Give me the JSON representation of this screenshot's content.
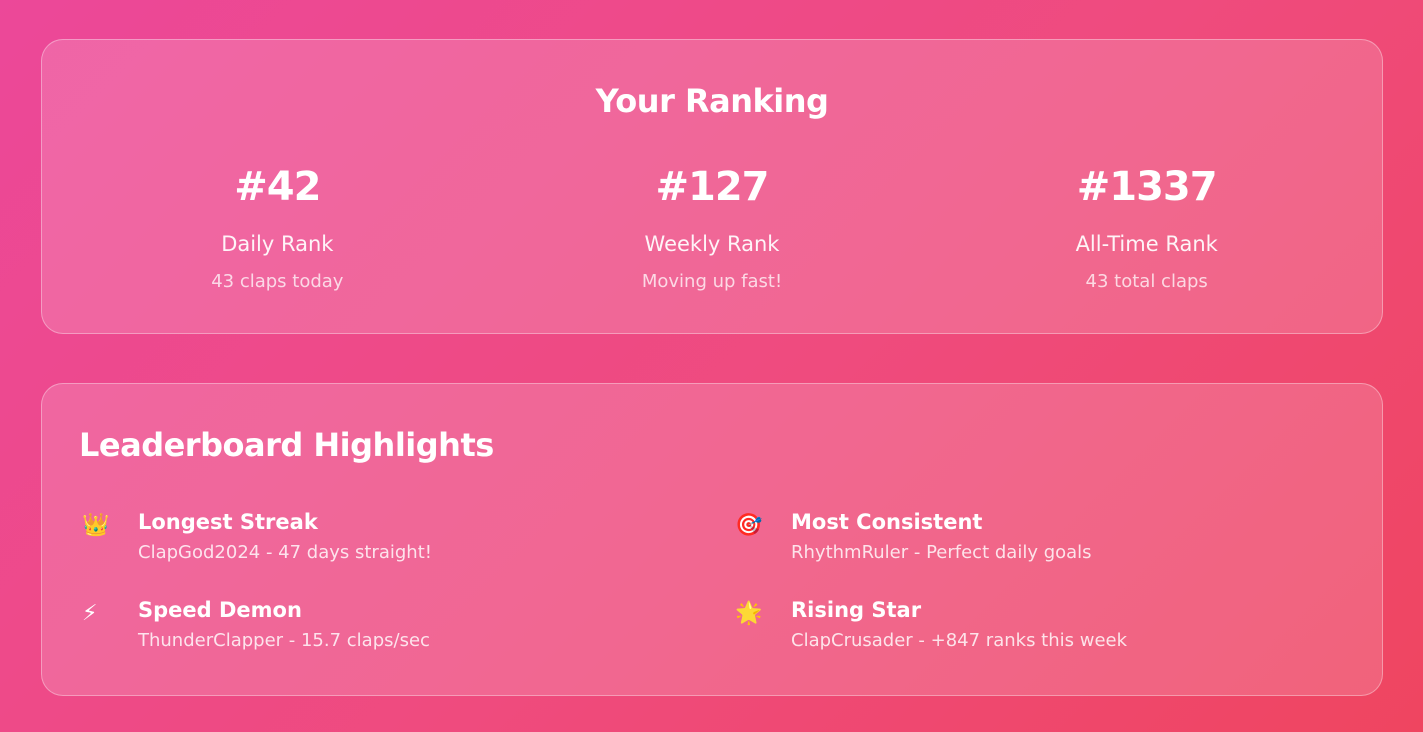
{
  "ranking": {
    "title": "Your Ranking",
    "items": [
      {
        "value": "#42",
        "label": "Daily Rank",
        "sub": "43 claps today"
      },
      {
        "value": "#127",
        "label": "Weekly Rank",
        "sub": "Moving up fast!"
      },
      {
        "value": "#1337",
        "label": "All-Time Rank",
        "sub": "43 total claps"
      }
    ]
  },
  "highlights": {
    "title": "Leaderboard Highlights",
    "items": [
      {
        "icon": "crown-icon",
        "glyph": "👑",
        "name": "Longest Streak",
        "desc": "ClapGod2024 - 47 days straight!"
      },
      {
        "icon": "target-icon",
        "glyph": "🎯",
        "name": "Most Consistent",
        "desc": "RhythmRuler - Perfect daily goals"
      },
      {
        "icon": "lightning-icon",
        "glyph": "⚡",
        "name": "Speed Demon",
        "desc": "ThunderClapper - 15.7 claps/sec"
      },
      {
        "icon": "star-icon",
        "glyph": "🌟",
        "name": "Rising Star",
        "desc": "ClapCrusader - +847 ranks this week"
      }
    ]
  },
  "colors": {
    "background_start": "#ec4899",
    "background_end": "#ef4560",
    "text": "#ffffff"
  }
}
